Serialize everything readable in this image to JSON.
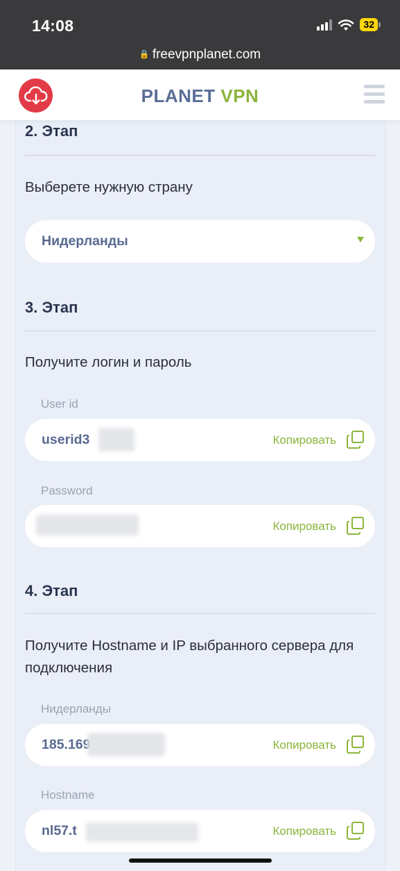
{
  "status_bar": {
    "time": "14:08",
    "battery": "32",
    "url": "freevpnplanet.com"
  },
  "header": {
    "brand_part1": "PLANET",
    "brand_part2": "VPN",
    "logo_icon": "cloud-download-icon",
    "menu_icon": "hamburger-menu-icon"
  },
  "stage2": {
    "title": "2. Этап",
    "description": "Выберете нужную страну",
    "country_selected": "Нидерланды"
  },
  "stage3": {
    "title": "3. Этап",
    "description": "Получите логин и пароль",
    "userid_label": "User id",
    "userid_value": "userid3",
    "password_label": "Password",
    "password_value": ""
  },
  "stage4": {
    "title": "4. Этап",
    "description": "Получите Hostname и IP выбранного сервера для подключения",
    "ip_label": "Нидерланды",
    "ip_value": "185.169",
    "hostname_label": "Hostname",
    "hostname_value": "nl57.t"
  },
  "copy_label": "Копировать",
  "colors": {
    "accent_green": "#8bb43b",
    "brand_blue": "#5a6d96",
    "logo_red": "#e23b47"
  }
}
